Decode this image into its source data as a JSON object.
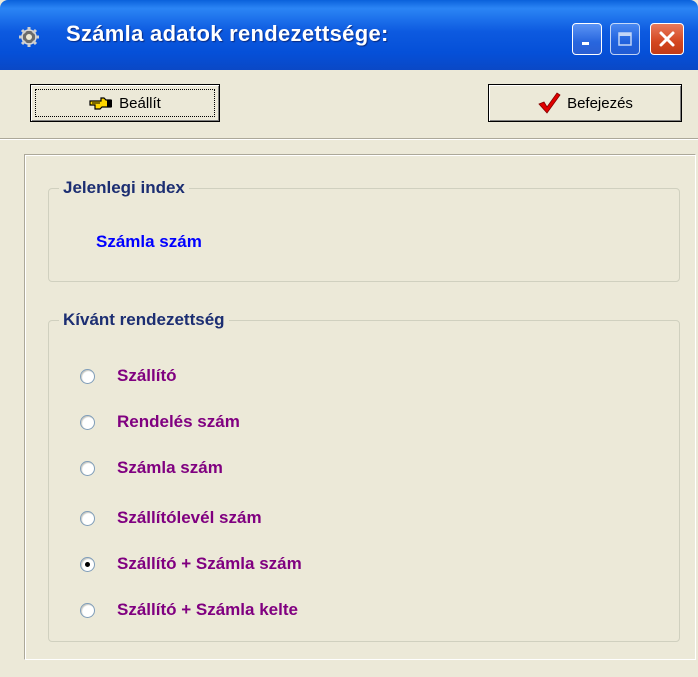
{
  "window": {
    "title": "Számla adatok rendezettsége:",
    "icon": "gear-icon"
  },
  "toolbar": {
    "set_label": "Beállít",
    "set_icon": "pointing-hand-icon",
    "finish_label": "Befejezés",
    "finish_icon": "red-checkmark-icon"
  },
  "current_index": {
    "legend": "Jelenlegi index",
    "value": "Számla szám"
  },
  "desired_order": {
    "legend": "Kívánt rendezettség",
    "selected": "Szállító + Számla szám",
    "options": [
      {
        "label": "Szállító"
      },
      {
        "label": "Rendelés szám"
      },
      {
        "label": "Számla szám"
      },
      {
        "label": "Szállítólevél szám"
      },
      {
        "label": "Szállító + Számla szám"
      },
      {
        "label": "Szállító + Számla kelte"
      }
    ]
  },
  "colors": {
    "titlebar": "#0550D8",
    "index_value": "#0000FF",
    "option_text": "#800080",
    "legend_text": "#1C2E72",
    "close_button": "#D4461F"
  }
}
